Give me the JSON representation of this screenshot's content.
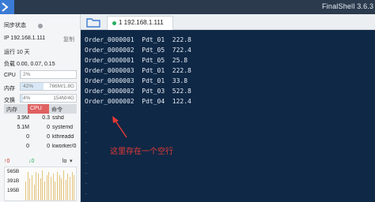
{
  "app": {
    "title": "FinalShell 3.6.3"
  },
  "sidebar": {
    "sync_status": "同步状态",
    "ip": "IP 192.168.1.111",
    "copy": "复制",
    "uptime": "运行 10 天",
    "load": "负载 0.00, 0.07, 0.15",
    "cpu": {
      "label": "CPU",
      "pct": "2%",
      "fraction": 0.02
    },
    "mem": {
      "label": "内存",
      "pct": "42%",
      "value": "766M/1.8G",
      "fraction": 0.42
    },
    "swap": {
      "label": "交换",
      "pct": "4%",
      "value": "154M/4G",
      "fraction": 0.04
    },
    "process_headers": {
      "mem": "内存",
      "cpu": "CPU",
      "cmd": "命令"
    },
    "processes": [
      {
        "mem": "3.9M",
        "cpu": "0.3",
        "cmd": "sshd"
      },
      {
        "mem": "5.1M",
        "cpu": "0",
        "cmd": "systemd"
      },
      {
        "mem": "0",
        "cpu": "0",
        "cmd": "kthreadd"
      },
      {
        "mem": "0",
        "cpu": "0",
        "cmd": "kworker/0:"
      }
    ],
    "network": {
      "up": "0",
      "down": "0",
      "interface": "lo"
    },
    "net_chart": {
      "y_labels": [
        "565B",
        "391B",
        "195B"
      ],
      "bars": [
        0.6,
        0.9,
        0.7,
        0.8,
        0.5,
        0.9,
        0.85,
        0.7,
        0.95,
        0.6,
        0.8,
        0.9,
        0.75,
        0.85,
        0.6,
        0.9,
        0.8,
        0.7,
        0.95,
        0.65,
        0.85,
        0.75,
        0.9,
        0.8
      ]
    }
  },
  "tabs": [
    {
      "label": "1 192.168.1.111"
    }
  ],
  "terminal": {
    "lines": [
      "Order_0000001  Pdt_01  222.8",
      "Order_0000002  Pdt_05  722.4",
      "Order_0000001  Pdt_05  25.8",
      "Order_0000003  Pdt_01  222.8",
      "Order_0000003  Pdt_01  33.8",
      "Order_0000002  Pdt_03  522.8",
      "Order_0000002  Pdt_04  122.4"
    ],
    "annotation": "这里存在一个空行"
  },
  "colors": {
    "titlebar": "#2b3a4d",
    "terminal_bg": "#0f2846",
    "accent_red": "#e53935"
  }
}
